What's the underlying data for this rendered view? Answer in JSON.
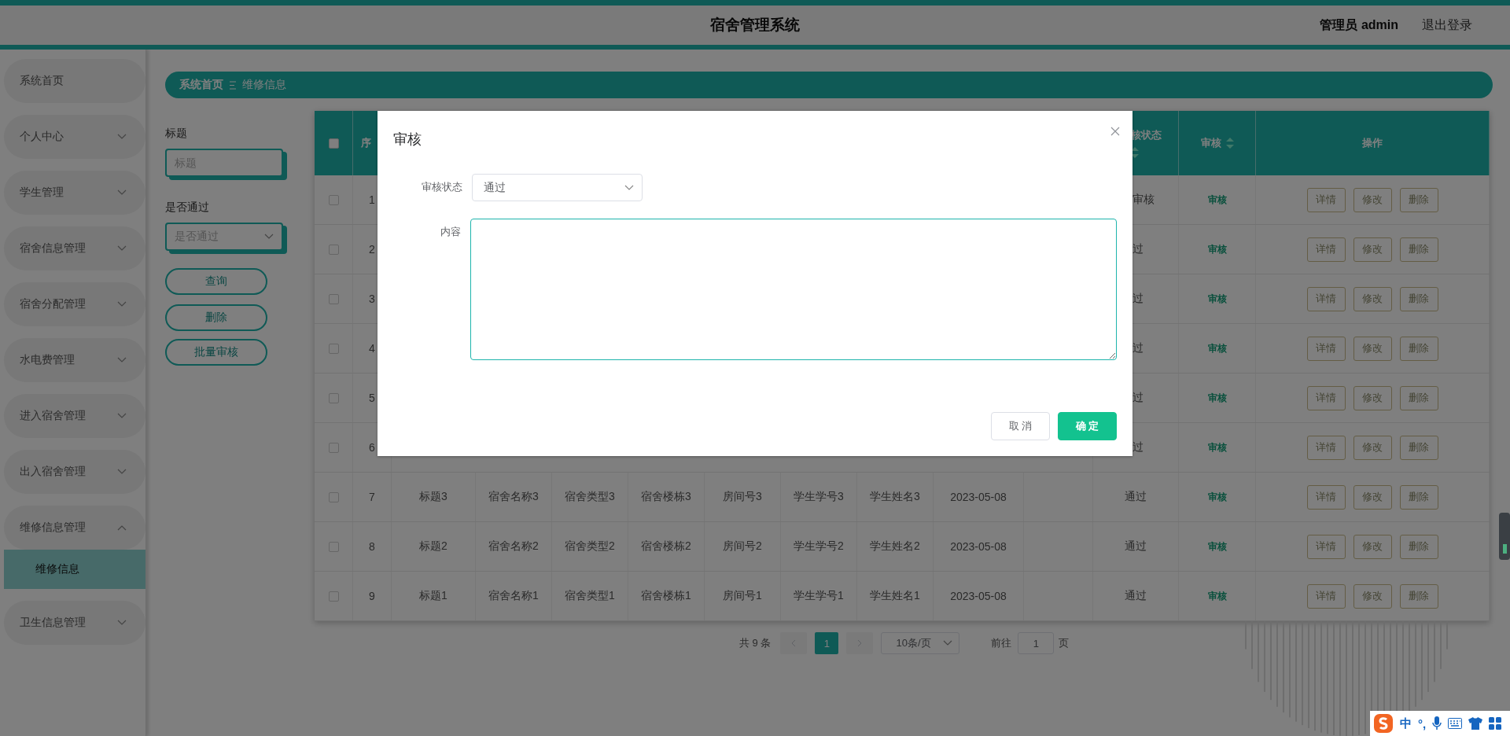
{
  "header": {
    "title": "宿舍管理系统",
    "user": "管理员 admin",
    "logout": "退出登录"
  },
  "sidebar": {
    "items": [
      {
        "label": "系统首页",
        "kind": "link"
      },
      {
        "label": "个人中心",
        "kind": "menu",
        "expanded": false
      },
      {
        "label": "学生管理",
        "kind": "menu",
        "expanded": false
      },
      {
        "label": "宿舍信息管理",
        "kind": "menu",
        "expanded": false
      },
      {
        "label": "宿舍分配管理",
        "kind": "menu",
        "expanded": false
      },
      {
        "label": "水电费管理",
        "kind": "menu",
        "expanded": false
      },
      {
        "label": "进入宿舍管理",
        "kind": "menu",
        "expanded": false
      },
      {
        "label": "出入宿舍管理",
        "kind": "menu",
        "expanded": false
      },
      {
        "label": "维修信息管理",
        "kind": "menu",
        "expanded": true,
        "children": [
          {
            "label": "维修信息",
            "selected": true
          }
        ]
      },
      {
        "label": "卫生信息管理",
        "kind": "menu",
        "expanded": false
      }
    ]
  },
  "breadcrumb": [
    "系统首页",
    "维修信息"
  ],
  "filters": [
    {
      "label": "标题",
      "kind": "input",
      "placeholder": "标题"
    },
    {
      "label": "是否通过",
      "kind": "select",
      "placeholder": "是否通过"
    }
  ],
  "filter_buttons": [
    "查询",
    "删除",
    "批量审核"
  ],
  "table": {
    "select_all": {
      "checked": false
    },
    "columns": [
      {
        "label": "序"
      },
      {
        "label": "核状态",
        "sortable": true
      },
      {
        "label": "审核",
        "sortable": true
      },
      {
        "label": "操作"
      }
    ],
    "rows": [
      {
        "kind": "covered",
        "checked": false,
        "index": "1",
        "status": "审核",
        "audit": "审核",
        "actions": [
          "详情",
          "修改",
          "删除"
        ]
      },
      {
        "kind": "covered",
        "checked": false,
        "index": "2",
        "status": "过",
        "audit": "审核",
        "actions": [
          "详情",
          "修改",
          "删除"
        ]
      },
      {
        "kind": "covered",
        "checked": false,
        "index": "3",
        "status": "过",
        "audit": "审核",
        "actions": [
          "详情",
          "修改",
          "删除"
        ]
      },
      {
        "kind": "covered",
        "checked": false,
        "index": "4",
        "status": "过",
        "audit": "审核",
        "actions": [
          "详情",
          "修改",
          "删除"
        ]
      },
      {
        "kind": "covered",
        "checked": false,
        "index": "5",
        "status": "过",
        "audit": "审核",
        "actions": [
          "详情",
          "修改",
          "删除"
        ]
      },
      {
        "kind": "covered",
        "checked": false,
        "index": "6",
        "status": "过",
        "audit": "审核",
        "actions": [
          "详情",
          "修改",
          "删除"
        ]
      },
      {
        "kind": "full",
        "checked": false,
        "index": "7",
        "cells": [
          "标题3",
          "宿舍名称3",
          "宿舍类型3",
          "宿舍楼栋3",
          "房间号3",
          "学生学号3",
          "学生姓名3",
          "2023-05-08"
        ],
        "status": "通过",
        "audit": "审核",
        "actions": [
          "详情",
          "修改",
          "删除"
        ]
      },
      {
        "kind": "full",
        "checked": false,
        "index": "8",
        "cells": [
          "标题2",
          "宿舍名称2",
          "宿舍类型2",
          "宿舍楼栋2",
          "房间号2",
          "学生学号2",
          "学生姓名2",
          "2023-05-08"
        ],
        "status": "通过",
        "audit": "审核",
        "actions": [
          "详情",
          "修改",
          "删除"
        ]
      },
      {
        "kind": "full",
        "checked": false,
        "index": "9",
        "cells": [
          "标题1",
          "宿舍名称1",
          "宿舍类型1",
          "宿舍楼栋1",
          "房间号1",
          "学生学号1",
          "学生姓名1",
          "2023-05-08"
        ],
        "status": "通过",
        "audit": "审核",
        "actions": [
          "详情",
          "修改",
          "删除"
        ]
      }
    ]
  },
  "pagination": {
    "total": "共 9 条",
    "pages": [
      {
        "label": "1",
        "selected": true
      }
    ],
    "page_size": "10条/页",
    "goto_label": "前往",
    "goto_value": "1",
    "goto_suffix": "页"
  },
  "dialog": {
    "title": "审核",
    "fields": [
      {
        "label": "审核状态",
        "kind": "select",
        "value": "通过"
      },
      {
        "label": "内容",
        "kind": "textarea"
      }
    ],
    "buttons": [
      {
        "label": "取 消",
        "kind": "default"
      },
      {
        "label": "确 定",
        "kind": "primary"
      }
    ]
  },
  "ime_bar": {
    "mode": "中",
    "punct": "°,"
  }
}
